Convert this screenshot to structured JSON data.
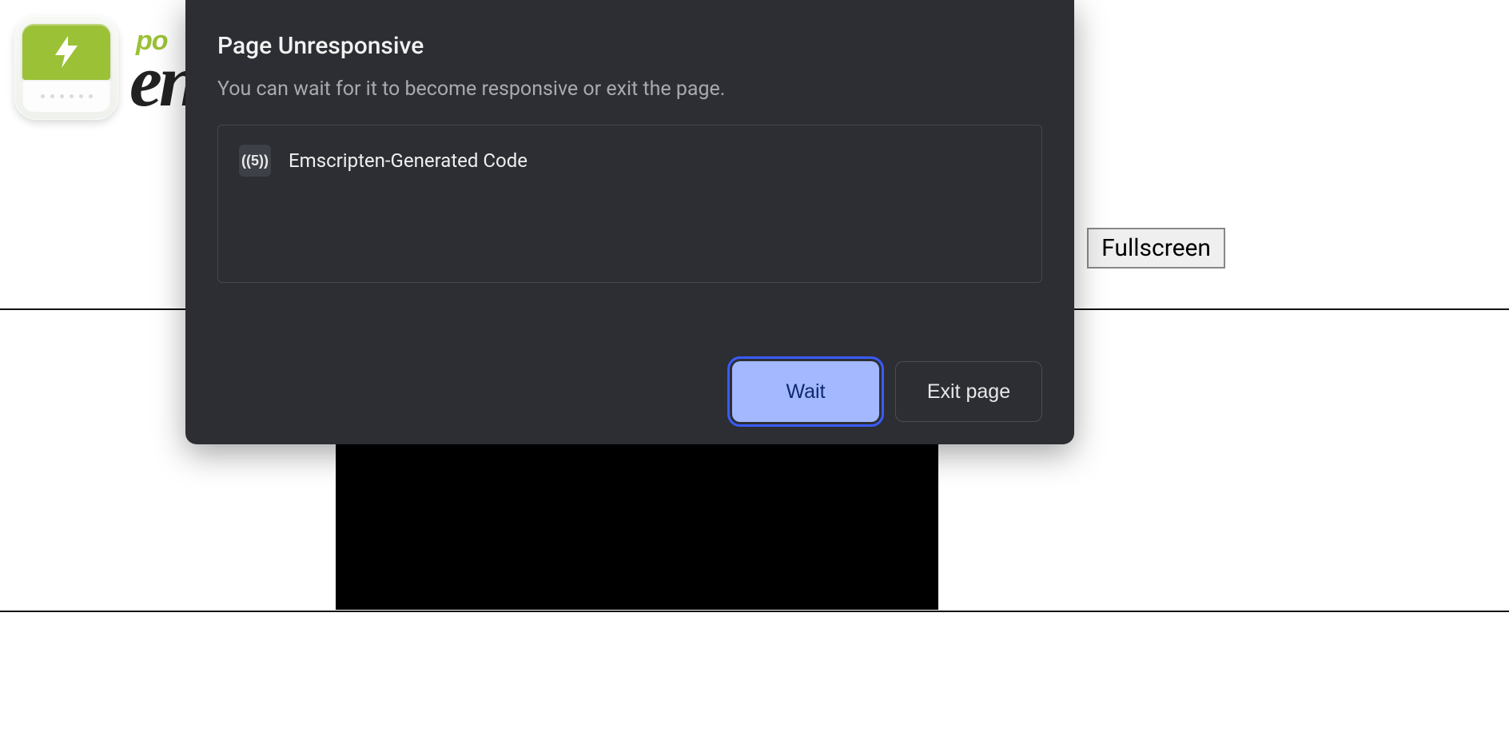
{
  "page": {
    "wordmark_top": "po",
    "wordmark_bottom": "en",
    "fullscreen_label": "Fullscreen"
  },
  "dialog": {
    "title": "Page Unresponsive",
    "subtitle": "You can wait for it to become responsive or exit the page.",
    "items": [
      {
        "favicon_text": "((5))",
        "label": "Emscripten-Generated Code"
      }
    ],
    "primary_label": "Wait",
    "secondary_label": "Exit page"
  }
}
